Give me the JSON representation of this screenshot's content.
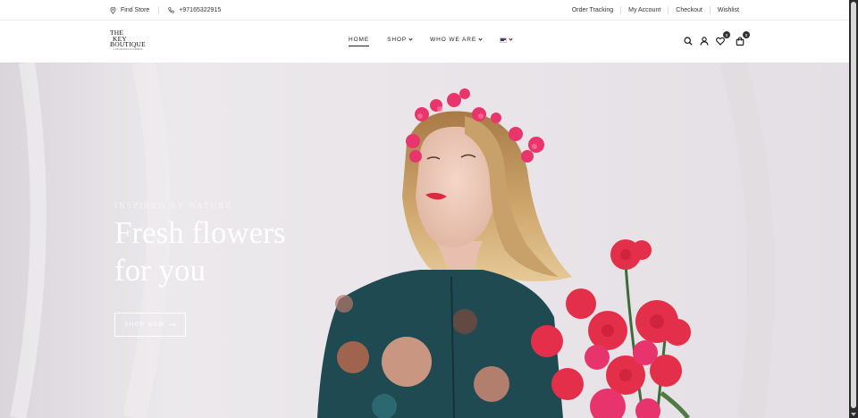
{
  "topbar": {
    "find_store": "Find Store",
    "phone": "+97165322915",
    "links": [
      "Order Tracking",
      "My Account",
      "Checkout",
      "Wishlist"
    ]
  },
  "logo": {
    "line1": "THE",
    "line2": "KEY",
    "line3": "BOUTIQUE",
    "tagline": "LUXURIOUS FLOWERS"
  },
  "nav": {
    "home": "HOME",
    "shop": "SHOP",
    "who_we_are": "WHO WE ARE"
  },
  "header_icons": {
    "wishlist_count": "0",
    "cart_count": "0"
  },
  "hero": {
    "eyebrow": "INSPIRED BY NATURE",
    "headline_line1": "Fresh flowers",
    "headline_line2": "for you",
    "cta": "SHOP NOW"
  },
  "colors": {
    "hero_bg": "#e6e2e6",
    "dress": "#1f4a52",
    "flowers": "#e8356b",
    "hair": "#c9a26a"
  }
}
